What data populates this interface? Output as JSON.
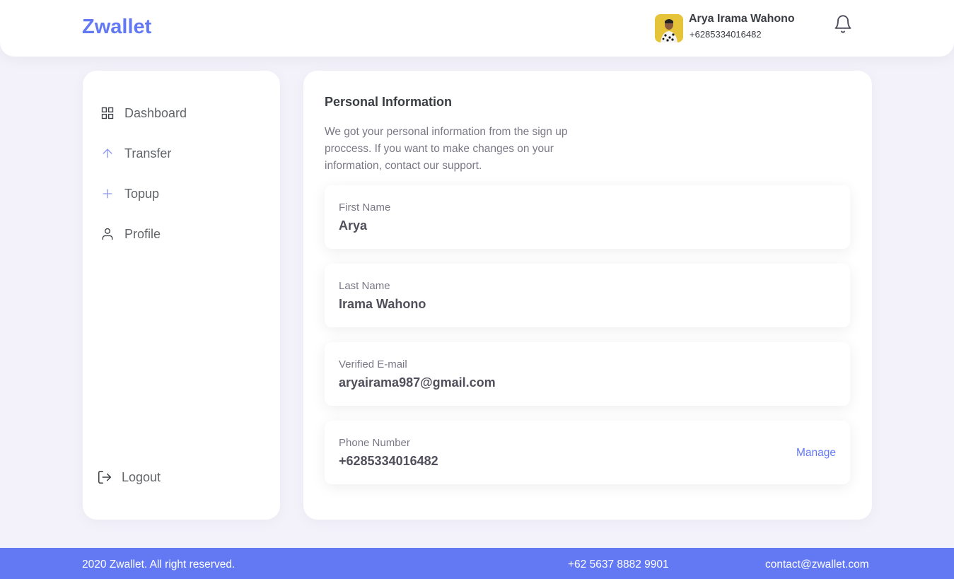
{
  "header": {
    "logo": "Zwallet",
    "user_name": "Arya Irama Wahono",
    "user_phone": "+6285334016482",
    "notification_icon": "bell-icon"
  },
  "sidebar": {
    "items": [
      {
        "label": "Dashboard",
        "icon": "grid-icon"
      },
      {
        "label": "Transfer",
        "icon": "arrow-up-icon"
      },
      {
        "label": "Topup",
        "icon": "plus-icon"
      },
      {
        "label": "Profile",
        "icon": "user-icon"
      }
    ],
    "logout": {
      "label": "Logout",
      "icon": "logout-icon"
    }
  },
  "main": {
    "title": "Personal Information",
    "description": "We got your personal information from the sign up proccess. If you want to make changes on your information, contact our support.",
    "fields": [
      {
        "label": "First Name",
        "value": "Arya"
      },
      {
        "label": "Last Name",
        "value": "Irama Wahono"
      },
      {
        "label": "Verified E-mail",
        "value": "aryairama987@gmail.com"
      },
      {
        "label": "Phone Number",
        "value": "+6285334016482",
        "action": "Manage"
      }
    ]
  },
  "footer": {
    "copyright": "2020 Zwallet. All right reserved.",
    "phone": "+62 5637 8882 9901",
    "email": "contact@zwallet.com"
  },
  "colors": {
    "accent": "#6379f4",
    "background": "#f3f2fb",
    "text": "#3a3d42",
    "muted": "#7a7886"
  }
}
